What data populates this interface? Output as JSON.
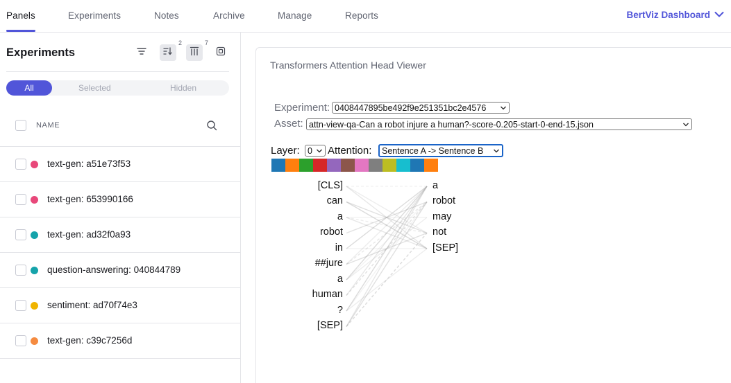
{
  "nav": {
    "tabs": [
      "Panels",
      "Experiments",
      "Notes",
      "Archive",
      "Manage",
      "Reports"
    ],
    "dashboard": "BertViz Dashboard"
  },
  "sidebar": {
    "title": "Experiments",
    "tool_counts": {
      "sort": "2",
      "columns": "7"
    },
    "segments": [
      "All",
      "Selected",
      "Hidden"
    ],
    "column_name": "NAME",
    "experiments": [
      {
        "name": "text-gen: a51e73f53",
        "color": "#e8487a"
      },
      {
        "name": "text-gen: 653990166",
        "color": "#e8487a"
      },
      {
        "name": "text-gen: ad32f0a93",
        "color": "#15a3aa"
      },
      {
        "name": "question-answering: 040844789",
        "color": "#15a3aa"
      },
      {
        "name": "sentiment: ad70f74e3",
        "color": "#f0b400"
      },
      {
        "name": "text-gen: c39c7256d",
        "color": "#f58b40"
      }
    ]
  },
  "panel": {
    "title": "Transformers Attention Head Viewer",
    "experiment_label": "Experiment:",
    "experiment_value": "0408447895be492f9e251351bc2e4576",
    "asset_label": "Asset:",
    "asset_value": "attn-view-qa-Can a robot injure a human?-score-0.205-start-0-end-15.json",
    "layer_label": "Layer:",
    "layer_value": "0",
    "attention_label": "Attention:",
    "attention_value": "Sentence A -> Sentence B",
    "head_colors": [
      "#1f77b4",
      "#ff7f0e",
      "#2ca02c",
      "#d62728",
      "#9467bd",
      "#8c564b",
      "#e377c2",
      "#7f7f7f",
      "#bcbd22",
      "#17becf",
      "#1f77b4",
      "#ff7f0e"
    ],
    "left_tokens": [
      "[CLS]",
      "can",
      "a",
      "robot",
      "in",
      "##jure",
      "a",
      "human",
      "?",
      "[SEP]"
    ],
    "right_tokens": [
      "a",
      "robot",
      "may",
      "not",
      "[SEP]"
    ]
  }
}
